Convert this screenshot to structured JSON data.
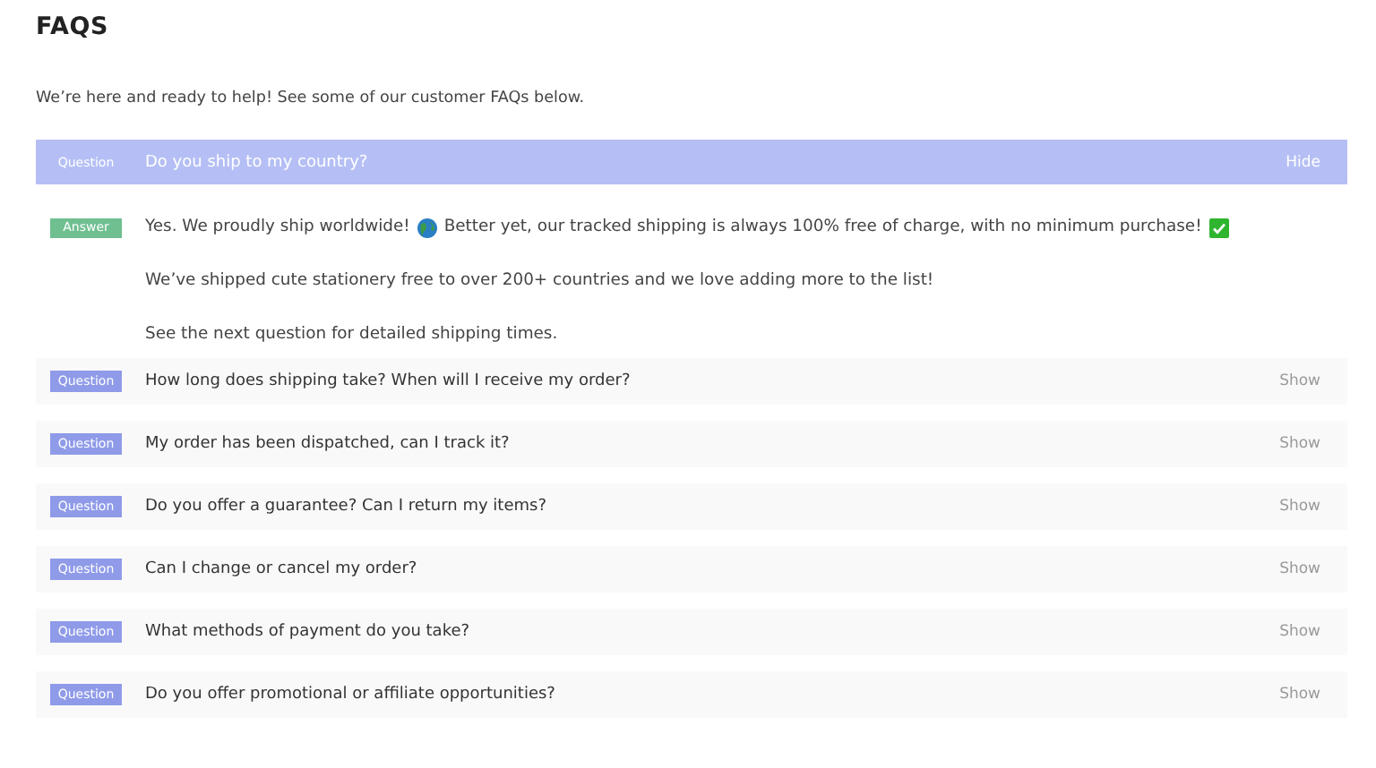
{
  "heading": "FAQS",
  "intro": "We’re here and ready to help! See some of our customer FAQs below.",
  "faqs": [
    {
      "tag": "Question",
      "question": "Do you ship to my country?",
      "toggle": "Hide",
      "expanded": true,
      "answer": {
        "tag": "Answer",
        "paragraphs": [
          [
            {
              "kind": "text",
              "text": "Yes. We proudly ship worldwide!"
            },
            {
              "kind": "globe"
            },
            {
              "kind": "text",
              "text": "Better yet, our tracked shipping is always 100% free of charge, with no minimum purchase!"
            },
            {
              "kind": "check"
            }
          ],
          [
            {
              "kind": "text",
              "text": "We’ve shipped cute stationery free to over 200+ countries and we love adding more to the list!"
            }
          ],
          [
            {
              "kind": "text",
              "text": "See the next question for detailed shipping times."
            }
          ]
        ]
      }
    },
    {
      "tag": "Question",
      "question": "How long does shipping take? When will I receive my order?",
      "toggle": "Show",
      "expanded": false
    },
    {
      "tag": "Question",
      "question": "My order has been dispatched, can I track it?",
      "toggle": "Show",
      "expanded": false
    },
    {
      "tag": "Question",
      "question": "Do you offer a guarantee? Can I return my items?",
      "toggle": "Show",
      "expanded": false
    },
    {
      "tag": "Question",
      "question": "Can I change or cancel my order?",
      "toggle": "Show",
      "expanded": false
    },
    {
      "tag": "Question",
      "question": "What methods of payment do you take?",
      "toggle": "Show",
      "expanded": false
    },
    {
      "tag": "Question",
      "question": "Do you offer promotional or affiliate opportunities?",
      "toggle": "Show",
      "expanded": false
    }
  ]
}
